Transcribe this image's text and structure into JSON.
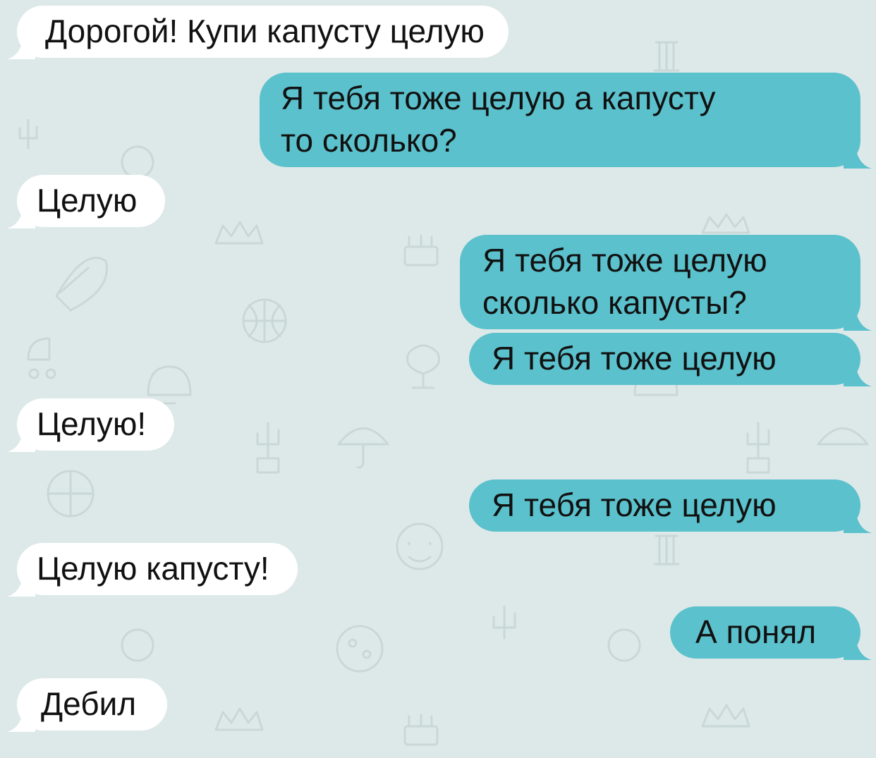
{
  "colors": {
    "background": "#dde9e8",
    "incoming_bubble": "#ffffff",
    "outgoing_bubble": "#5bc1cc",
    "text": "#111111",
    "pattern": "#c9d8d7"
  },
  "messages": [
    {
      "side": "in",
      "lines": [
        "Дорогой! Купи капусту целую"
      ]
    },
    {
      "side": "out",
      "lines": [
        "Я тебя тоже целую а капусту",
        "то сколько?"
      ]
    },
    {
      "side": "in",
      "lines": [
        "Целую"
      ]
    },
    {
      "side": "out",
      "lines": [
        "Я тебя тоже целую",
        "сколько капусты?"
      ]
    },
    {
      "side": "out",
      "lines": [
        "Я тебя тоже целую"
      ]
    },
    {
      "side": "in",
      "lines": [
        "Целую!"
      ]
    },
    {
      "side": "out",
      "lines": [
        "Я тебя тоже целую"
      ]
    },
    {
      "side": "in",
      "lines": [
        "Целую капусту!"
      ]
    },
    {
      "side": "out",
      "lines": [
        "А понял"
      ]
    },
    {
      "side": "in",
      "lines": [
        "Дебил"
      ]
    }
  ],
  "background_icons": [
    "crown-icon",
    "cake-icon",
    "leaf-icon",
    "basketball-icon",
    "ice-cream-icon",
    "stroller-icon",
    "cactus-icon",
    "umbrella-icon",
    "smiley-icon",
    "column-icon",
    "pizza-icon",
    "lightbulb-icon",
    "bell-icon"
  ]
}
